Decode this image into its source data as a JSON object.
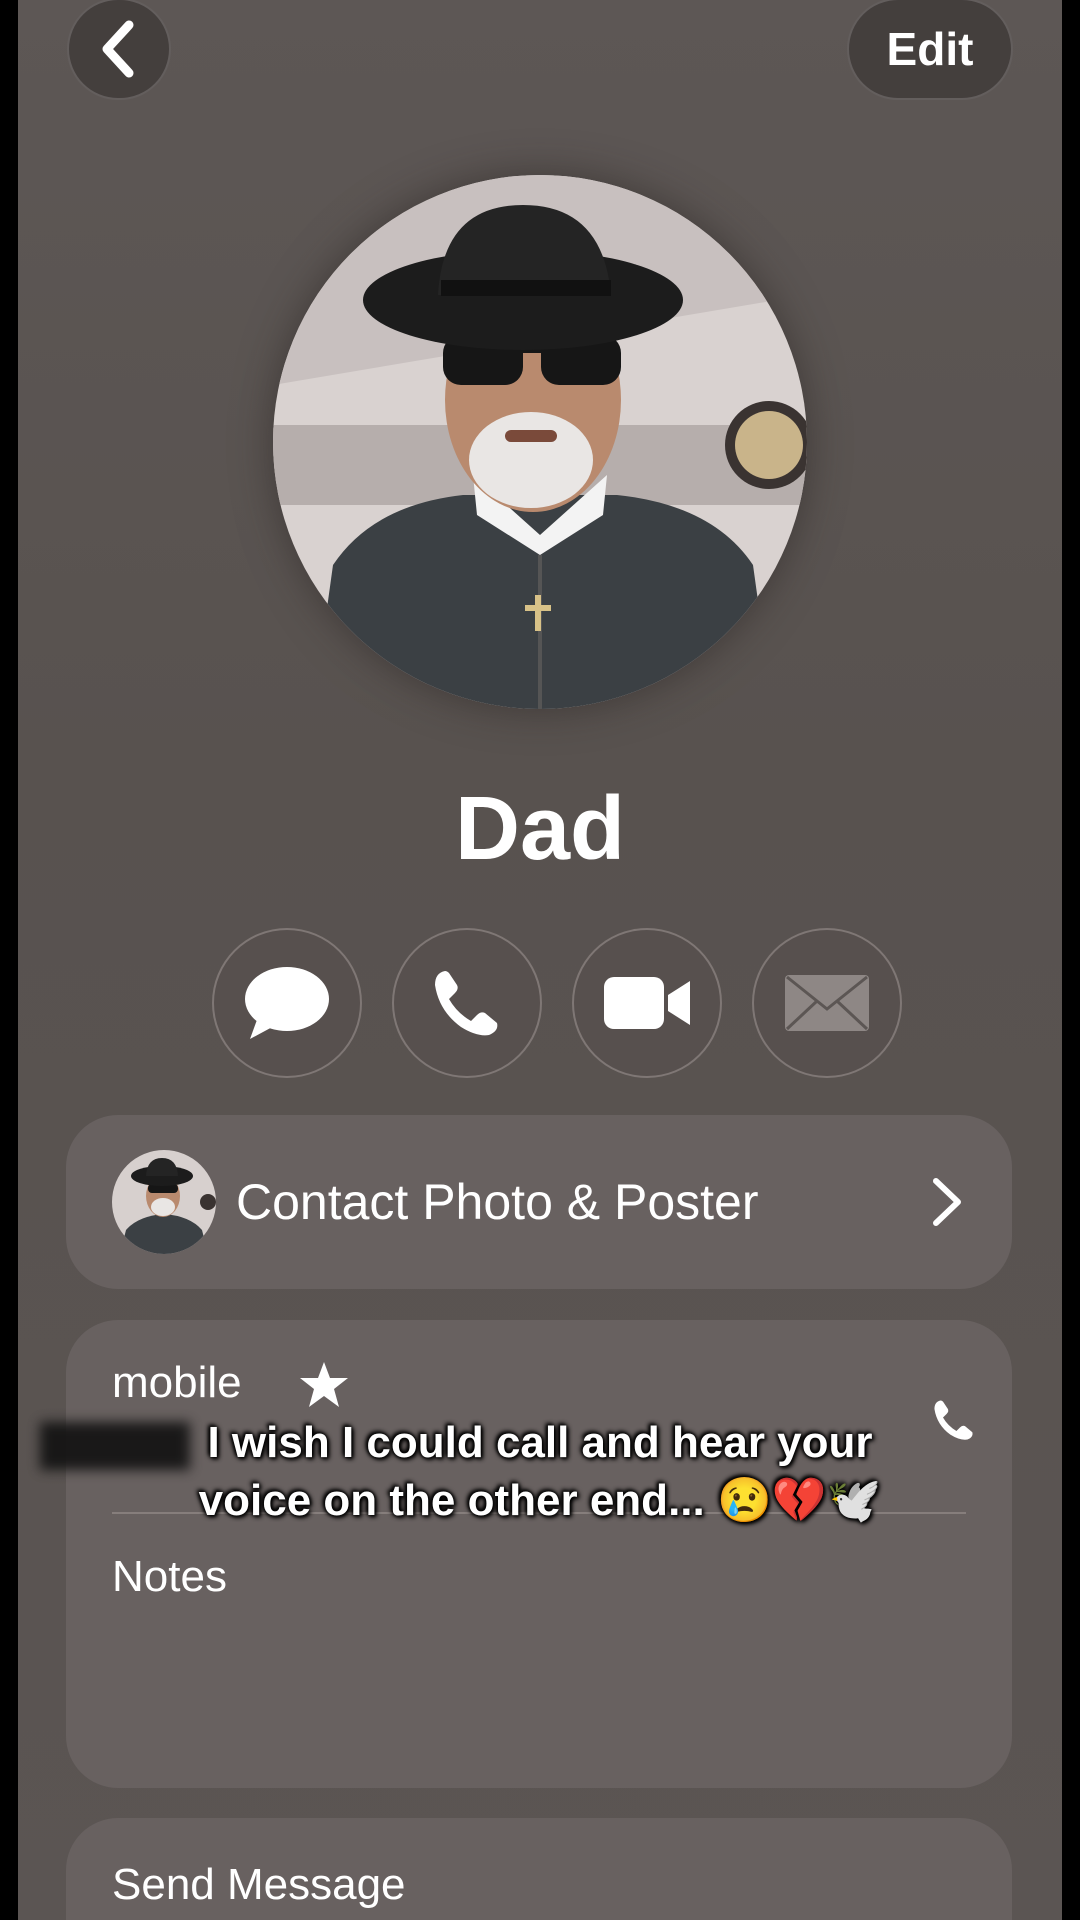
{
  "header": {
    "edit_label": "Edit"
  },
  "contact": {
    "name": "Dad"
  },
  "actions": [
    {
      "name": "message",
      "icon": "message-bubble-icon"
    },
    {
      "name": "call",
      "icon": "phone-icon"
    },
    {
      "name": "video",
      "icon": "video-camera-icon"
    },
    {
      "name": "mail",
      "icon": "envelope-icon"
    }
  ],
  "photo_poster": {
    "label": "Contact Photo & Poster"
  },
  "phone": {
    "label": "mobile"
  },
  "notes": {
    "label": "Notes"
  },
  "send_message": {
    "label": "Send Message"
  },
  "overlay_caption": {
    "line1": "I wish I could call and hear your",
    "line2": "voice on the other end... 😢💔🕊️"
  },
  "colors": {
    "background": "#5a5452",
    "card": "#686160",
    "text": "#ffffff"
  }
}
